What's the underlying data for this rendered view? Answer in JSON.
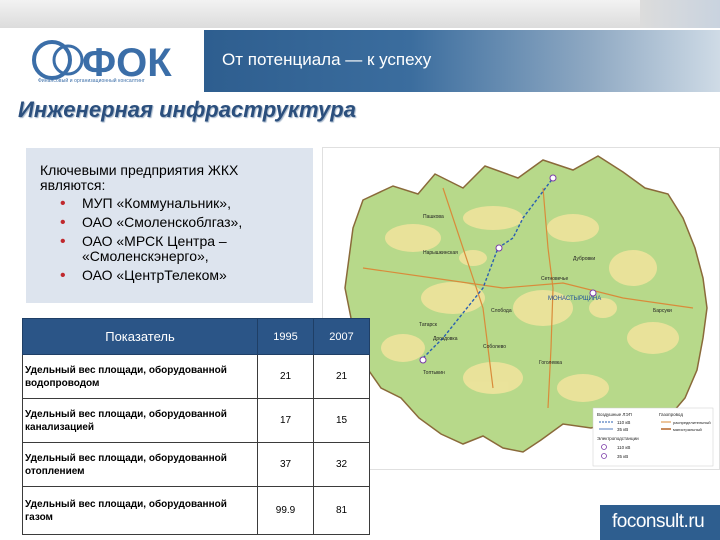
{
  "header": {
    "logo_text": "ФОК",
    "logo_subtitle": "Финансовый и организационный консалтинг",
    "slogan": "От потенциала — к успеху"
  },
  "slide": {
    "title": "Инженерная инфраструктура",
    "lead": "Ключевыми предприятия ЖКХ являются:",
    "bullets": [
      "МУП «Коммунальник»,",
      "ОАО «Смоленскоблгаз»,",
      "ОАО «МРСК Центра – «Смоленскэнерго»,",
      "ОАО «ЦентрТелеком»"
    ]
  },
  "table": {
    "headers": [
      "Показатель",
      "1995",
      "2007"
    ],
    "rows": [
      {
        "label": "Удельный вес площади, оборудованной водопроводом",
        "v1995": "21",
        "v2007": "21"
      },
      {
        "label": "Удельный вес площади, оборудованной канализацией",
        "v1995": "17",
        "v2007": "15"
      },
      {
        "label": "Удельный вес площади, оборудованной отоплением",
        "v1995": "37",
        "v2007": "32"
      },
      {
        "label": "Удельный вес площади, оборудованной газом",
        "v1995": "99.9",
        "v2007": "81"
      }
    ]
  },
  "map": {
    "places": [
      "Нарышкинская",
      "Пашкова",
      "Дубровки",
      "Сетновечье",
      "МОНАСТЫРЩИНА",
      "Слобода",
      "Барсуки",
      "Татарск",
      "Дроздовка",
      "Соболево",
      "Гоголевка",
      "Топтыкин"
    ],
    "legend": {
      "lines_title": "Воздушные ЛЭП",
      "line_items": [
        "110 кВ",
        "35 кВ"
      ],
      "gas_title": "Газопровод",
      "gas_items": [
        "распределительный",
        "магистральный"
      ],
      "substations_title": "Электроподстанции",
      "substation_items": [
        "110 кВ",
        "35 кВ"
      ]
    }
  },
  "footer": {
    "brand": "foconsult.ru"
  },
  "colors": {
    "brand_blue": "#2b5587",
    "bullet_red": "#c0282d",
    "map_green": "#b7d98a",
    "map_yellow": "#efe39c"
  }
}
